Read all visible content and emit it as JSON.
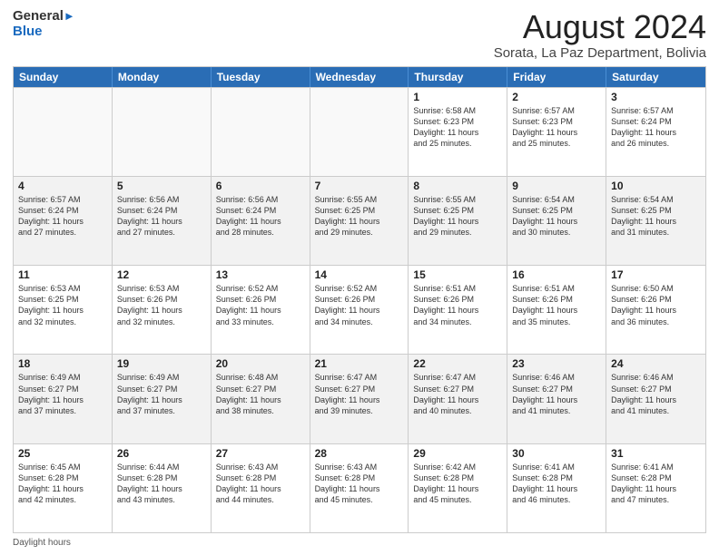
{
  "header": {
    "logo_line1": "General",
    "logo_line2": "Blue",
    "month_title": "August 2024",
    "subtitle": "Sorata, La Paz Department, Bolivia"
  },
  "days_of_week": [
    "Sunday",
    "Monday",
    "Tuesday",
    "Wednesday",
    "Thursday",
    "Friday",
    "Saturday"
  ],
  "footer": {
    "label": "Daylight hours"
  },
  "weeks": [
    [
      {
        "day": "",
        "info": "",
        "empty": true
      },
      {
        "day": "",
        "info": "",
        "empty": true
      },
      {
        "day": "",
        "info": "",
        "empty": true
      },
      {
        "day": "",
        "info": "",
        "empty": true
      },
      {
        "day": "1",
        "info": "Sunrise: 6:58 AM\nSunset: 6:23 PM\nDaylight: 11 hours\nand 25 minutes.",
        "empty": false
      },
      {
        "day": "2",
        "info": "Sunrise: 6:57 AM\nSunset: 6:23 PM\nDaylight: 11 hours\nand 25 minutes.",
        "empty": false
      },
      {
        "day": "3",
        "info": "Sunrise: 6:57 AM\nSunset: 6:24 PM\nDaylight: 11 hours\nand 26 minutes.",
        "empty": false
      }
    ],
    [
      {
        "day": "4",
        "info": "Sunrise: 6:57 AM\nSunset: 6:24 PM\nDaylight: 11 hours\nand 27 minutes.",
        "empty": false
      },
      {
        "day": "5",
        "info": "Sunrise: 6:56 AM\nSunset: 6:24 PM\nDaylight: 11 hours\nand 27 minutes.",
        "empty": false
      },
      {
        "day": "6",
        "info": "Sunrise: 6:56 AM\nSunset: 6:24 PM\nDaylight: 11 hours\nand 28 minutes.",
        "empty": false
      },
      {
        "day": "7",
        "info": "Sunrise: 6:55 AM\nSunset: 6:25 PM\nDaylight: 11 hours\nand 29 minutes.",
        "empty": false
      },
      {
        "day": "8",
        "info": "Sunrise: 6:55 AM\nSunset: 6:25 PM\nDaylight: 11 hours\nand 29 minutes.",
        "empty": false
      },
      {
        "day": "9",
        "info": "Sunrise: 6:54 AM\nSunset: 6:25 PM\nDaylight: 11 hours\nand 30 minutes.",
        "empty": false
      },
      {
        "day": "10",
        "info": "Sunrise: 6:54 AM\nSunset: 6:25 PM\nDaylight: 11 hours\nand 31 minutes.",
        "empty": false
      }
    ],
    [
      {
        "day": "11",
        "info": "Sunrise: 6:53 AM\nSunset: 6:25 PM\nDaylight: 11 hours\nand 32 minutes.",
        "empty": false
      },
      {
        "day": "12",
        "info": "Sunrise: 6:53 AM\nSunset: 6:26 PM\nDaylight: 11 hours\nand 32 minutes.",
        "empty": false
      },
      {
        "day": "13",
        "info": "Sunrise: 6:52 AM\nSunset: 6:26 PM\nDaylight: 11 hours\nand 33 minutes.",
        "empty": false
      },
      {
        "day": "14",
        "info": "Sunrise: 6:52 AM\nSunset: 6:26 PM\nDaylight: 11 hours\nand 34 minutes.",
        "empty": false
      },
      {
        "day": "15",
        "info": "Sunrise: 6:51 AM\nSunset: 6:26 PM\nDaylight: 11 hours\nand 34 minutes.",
        "empty": false
      },
      {
        "day": "16",
        "info": "Sunrise: 6:51 AM\nSunset: 6:26 PM\nDaylight: 11 hours\nand 35 minutes.",
        "empty": false
      },
      {
        "day": "17",
        "info": "Sunrise: 6:50 AM\nSunset: 6:26 PM\nDaylight: 11 hours\nand 36 minutes.",
        "empty": false
      }
    ],
    [
      {
        "day": "18",
        "info": "Sunrise: 6:49 AM\nSunset: 6:27 PM\nDaylight: 11 hours\nand 37 minutes.",
        "empty": false
      },
      {
        "day": "19",
        "info": "Sunrise: 6:49 AM\nSunset: 6:27 PM\nDaylight: 11 hours\nand 37 minutes.",
        "empty": false
      },
      {
        "day": "20",
        "info": "Sunrise: 6:48 AM\nSunset: 6:27 PM\nDaylight: 11 hours\nand 38 minutes.",
        "empty": false
      },
      {
        "day": "21",
        "info": "Sunrise: 6:47 AM\nSunset: 6:27 PM\nDaylight: 11 hours\nand 39 minutes.",
        "empty": false
      },
      {
        "day": "22",
        "info": "Sunrise: 6:47 AM\nSunset: 6:27 PM\nDaylight: 11 hours\nand 40 minutes.",
        "empty": false
      },
      {
        "day": "23",
        "info": "Sunrise: 6:46 AM\nSunset: 6:27 PM\nDaylight: 11 hours\nand 41 minutes.",
        "empty": false
      },
      {
        "day": "24",
        "info": "Sunrise: 6:46 AM\nSunset: 6:27 PM\nDaylight: 11 hours\nand 41 minutes.",
        "empty": false
      }
    ],
    [
      {
        "day": "25",
        "info": "Sunrise: 6:45 AM\nSunset: 6:28 PM\nDaylight: 11 hours\nand 42 minutes.",
        "empty": false
      },
      {
        "day": "26",
        "info": "Sunrise: 6:44 AM\nSunset: 6:28 PM\nDaylight: 11 hours\nand 43 minutes.",
        "empty": false
      },
      {
        "day": "27",
        "info": "Sunrise: 6:43 AM\nSunset: 6:28 PM\nDaylight: 11 hours\nand 44 minutes.",
        "empty": false
      },
      {
        "day": "28",
        "info": "Sunrise: 6:43 AM\nSunset: 6:28 PM\nDaylight: 11 hours\nand 45 minutes.",
        "empty": false
      },
      {
        "day": "29",
        "info": "Sunrise: 6:42 AM\nSunset: 6:28 PM\nDaylight: 11 hours\nand 45 minutes.",
        "empty": false
      },
      {
        "day": "30",
        "info": "Sunrise: 6:41 AM\nSunset: 6:28 PM\nDaylight: 11 hours\nand 46 minutes.",
        "empty": false
      },
      {
        "day": "31",
        "info": "Sunrise: 6:41 AM\nSunset: 6:28 PM\nDaylight: 11 hours\nand 47 minutes.",
        "empty": false
      }
    ]
  ]
}
